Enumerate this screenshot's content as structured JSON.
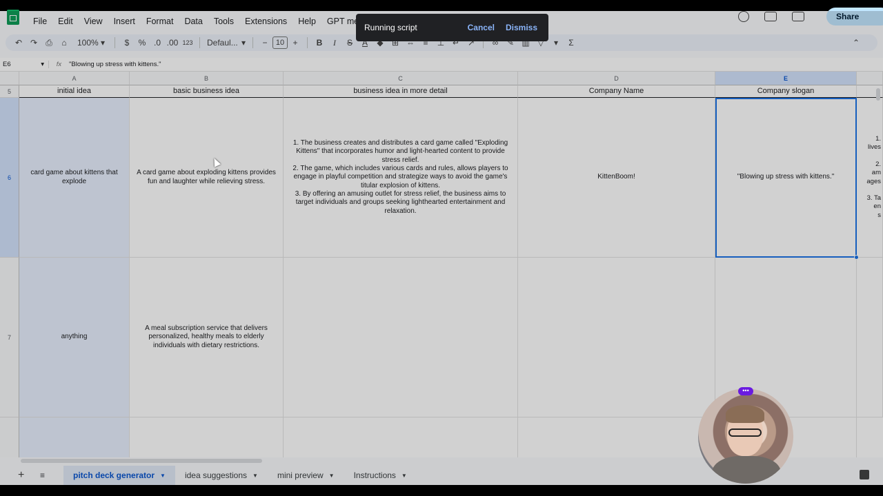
{
  "menu": [
    "File",
    "Edit",
    "View",
    "Insert",
    "Format",
    "Data",
    "Tools",
    "Extensions",
    "Help",
    "GPT menu"
  ],
  "top_right": {
    "share_label": "Share"
  },
  "toolbar": {
    "zoom": "100%",
    "currency": "$",
    "percent": "%",
    "decrease_decimal": ".0",
    "increase_decimal": ".00",
    "number_format": "123",
    "font": "Defaul...",
    "font_size": "10",
    "bold": "B",
    "italic": "I",
    "sum": "Σ"
  },
  "formula_bar": {
    "cell_ref": "E6",
    "fx": "fx",
    "value": "\"Blowing up stress with kittens.\""
  },
  "toast": {
    "message": "Running script",
    "cancel": "Cancel",
    "dismiss": "Dismiss"
  },
  "columns": [
    {
      "letter": "A",
      "header": "initial idea"
    },
    {
      "letter": "B",
      "header": "basic business idea"
    },
    {
      "letter": "C",
      "header": "business idea in more detail"
    },
    {
      "letter": "D",
      "header": "Company Name"
    },
    {
      "letter": "E",
      "header": "Company slogan"
    }
  ],
  "rows": [
    {
      "num": "5"
    },
    {
      "num": "6",
      "a": "card game about kittens that explode",
      "b": "A card game about exploding kittens provides fun and laughter while relieving stress.",
      "c": "1. The business creates and distributes a card game called \"Exploding Kittens\" that incorporates humor and light-hearted content to provide stress relief.\n2. The game, which includes various cards and rules, allows players to engage in playful competition and strategize ways to avoid the game's titular explosion of kittens.\n3. By offering an amusing outlet for stress relief, the business aims to target individuals and groups seeking lighthearted entertainment and relaxation.",
      "d": "KittenBoom!",
      "e": "\"Blowing up stress with kittens.\"",
      "f": "1.\nlives\n\n2.\nam\nages\n\n3. Ta\nen\ns"
    },
    {
      "num": "7",
      "a": "anything",
      "b": "A meal subscription service that delivers personalized, healthy meals to elderly individuals with dietary restrictions.",
      "c": "",
      "d": "",
      "e": ""
    }
  ],
  "sheet_tabs": [
    "pitch deck generator",
    "idea suggestions",
    "mini preview",
    "Instructions"
  ],
  "active_tab": "pitch deck generator",
  "colors": {
    "selection": "#1a73e8",
    "active_tab": "#0b57d0",
    "toast_bg": "#202124",
    "toast_button": "#8ab4f8",
    "sheets_green": "#0f9d58"
  }
}
